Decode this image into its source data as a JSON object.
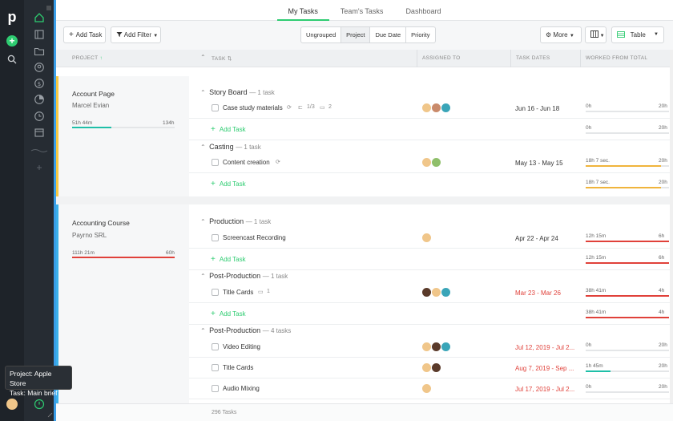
{
  "nav": {
    "tabs": [
      "My Tasks",
      "Team's Tasks",
      "Dashboard"
    ],
    "active": 0
  },
  "tooltip": {
    "project": "Project: Apple Store",
    "task": "Task: Main brief"
  },
  "toolbar": {
    "add_task": "Add Task",
    "add_filter": "Add Filter",
    "group_options": [
      "Ungrouped",
      "Project",
      "Due Date",
      "Priority"
    ],
    "group_selected": "Project",
    "more": "More",
    "table": "Table"
  },
  "columns": {
    "project": "PROJECT",
    "task": "TASK",
    "assigned": "ASSIGNED TO",
    "dates": "TASK DATES",
    "worked": "WORKED FROM TOTAL"
  },
  "add_task_label": "Add Task",
  "projects": [
    {
      "title": "Account Page",
      "client": "Marcel Evian",
      "worked": "51h 44m",
      "total": "134h",
      "progress": 0.38,
      "accent": "#f5c842",
      "bar_color": "#1fbfa8"
    },
    {
      "title": "Accounting Course",
      "client": "Payrno SRL",
      "worked": "111h 21m",
      "total": "60h",
      "progress": 1.0,
      "accent": "#3ab0ea",
      "bar_color": "#e0413a"
    }
  ],
  "groups": [
    {
      "name": "Story Board",
      "count": "— 1 task"
    },
    {
      "name": "Casting",
      "count": "— 1 task"
    },
    {
      "name": "Production",
      "count": "— 1 task"
    },
    {
      "name": "Post-Production",
      "count": "— 1 task"
    },
    {
      "name": "Post-Production",
      "count": "— 4 tasks"
    }
  ],
  "tasks": [
    {
      "name": "Case study materials",
      "subtasks": "1/3",
      "comments": "2",
      "dates": "Jun 16 - Jun 18",
      "overdue": false,
      "worked": "0h",
      "total": "20h",
      "progress": 0,
      "color": "#e4e6e8"
    },
    {
      "name": "Content creation",
      "dates": "May 13 - May 15",
      "overdue": false,
      "worked": "18h 7 sec.",
      "total": "20h",
      "progress": 0.9,
      "color": "#f0b43c"
    },
    {
      "name": "Screencast Recording",
      "dates": "Apr 22 - Apr 24",
      "overdue": false,
      "worked": "12h 15m",
      "total": "6h",
      "progress": 1.0,
      "color": "#e0413a"
    },
    {
      "name": "Title Cards",
      "comments": "1",
      "dates": "Mar 23 - Mar 26",
      "overdue": true,
      "worked": "38h 41m",
      "total": "4h",
      "progress": 1.0,
      "color": "#e0413a"
    },
    {
      "name": "Video Editing",
      "dates": "Jul 12, 2019 - Jul 2...",
      "overdue": true,
      "worked": "0h",
      "total": "20h",
      "progress": 0,
      "color": "#e4e6e8"
    },
    {
      "name": "Title Cards",
      "dates": "Aug 7, 2019 - Sep ...",
      "overdue": true,
      "worked": "1h 45m",
      "total": "20h",
      "progress": 0.3,
      "color": "#1fbfa8"
    },
    {
      "name": "Audio Mixing",
      "dates": "Jul 17, 2019 - Jul 2...",
      "overdue": true,
      "worked": "0h",
      "total": "20h",
      "progress": 0,
      "color": "#e4e6e8"
    }
  ],
  "add_rows": [
    {
      "worked": "0h",
      "total": "20h",
      "progress": 0,
      "color": "#e4e6e8"
    },
    {
      "worked": "18h 7 sec.",
      "total": "20h",
      "progress": 0.9,
      "color": "#f0b43c"
    },
    {
      "worked": "12h 15m",
      "total": "6h",
      "progress": 1.0,
      "color": "#e0413a"
    },
    {
      "worked": "38h 41m",
      "total": "4h",
      "progress": 1.0,
      "color": "#e0413a"
    }
  ],
  "footer": {
    "count": "296 Tasks"
  }
}
